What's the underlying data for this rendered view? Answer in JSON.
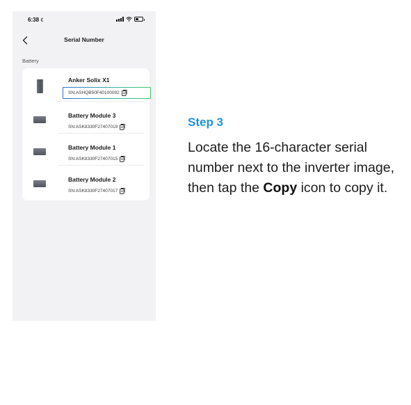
{
  "phone": {
    "status_bar": {
      "time": "6:38",
      "time_suffix_icon": "do-not-disturb-icon",
      "icons": [
        "cellular-signal-icon",
        "wifi-icon",
        "battery-icon"
      ]
    },
    "nav": {
      "back_icon": "chevron-left-icon",
      "title": "Serial Number"
    },
    "section_label": "Battery",
    "items": [
      {
        "name": "Anker Solix X1",
        "serial": "SN:ASHQB50F40100092",
        "icon": "inverter-icon",
        "copy_icon": "copy-icon",
        "highlighted": true
      },
      {
        "name": "Battery Module 3",
        "serial": "SN:ASK8330F27407019",
        "icon": "battery-module-icon",
        "copy_icon": "copy-icon",
        "highlighted": false
      },
      {
        "name": "Battery Module 1",
        "serial": "SN:ASK8330F27407015",
        "icon": "battery-module-icon",
        "copy_icon": "copy-icon",
        "highlighted": false
      },
      {
        "name": "Battery Module 2",
        "serial": "SN:ASK8330F27407017",
        "icon": "battery-module-icon",
        "copy_icon": "copy-icon",
        "highlighted": false
      }
    ],
    "highlight_colors": [
      "#2a6fd6",
      "#3fc86a"
    ]
  },
  "instructions": {
    "step_title": "Step 3",
    "step_title_colors": [
      "#1b8fe0",
      "#17b2c8"
    ],
    "body_before": "Locate the 16-character serial number next to the inverter image, then tap the ",
    "body_bold": "Copy",
    "body_after": " icon to copy it."
  }
}
